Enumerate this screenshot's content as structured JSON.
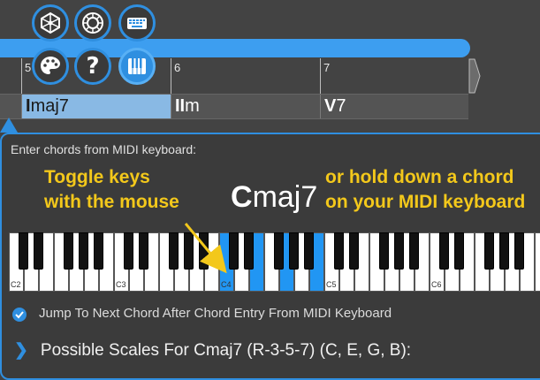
{
  "toolbar": {
    "buttons": [
      {
        "name": "network-icon"
      },
      {
        "name": "circle-of-fifths-icon"
      },
      {
        "name": "keyboard-icon"
      },
      {
        "name": "palette-icon"
      },
      {
        "name": "help-icon",
        "glyph": "?"
      },
      {
        "name": "piano-icon",
        "active": true
      }
    ],
    "accent": "#2f8fe0"
  },
  "timeline": {
    "measures": [
      "5",
      "6",
      "7"
    ]
  },
  "chord_lane": {
    "chords": [
      {
        "numeral": "I",
        "quality": "maj7",
        "selected": true
      },
      {
        "numeral": "II",
        "quality": "m",
        "selected": false
      },
      {
        "numeral": "V",
        "quality": "7",
        "selected": false
      }
    ]
  },
  "panel": {
    "title": "Enter chords from MIDI keyboard:",
    "hint_left_1": "Toggle keys",
    "hint_left_2": "with the mouse",
    "hint_right_1": "or hold down a chord",
    "hint_right_2": "on your MIDI keyboard",
    "chord_root": "C",
    "chord_quality": "maj7",
    "highlight_color": "#f3c81b"
  },
  "keyboard": {
    "octave_labels": [
      "C2",
      "C3",
      "C4",
      "C5",
      "C6"
    ],
    "active_notes": [
      "C4",
      "E4",
      "G4",
      "B4"
    ]
  },
  "options": {
    "jump_label": "Jump To Next Chord After Chord Entry From MIDI Keyboard",
    "jump_checked": true
  },
  "scales": {
    "label": "Possible Scales For Cmaj7 (R-3-5-7) (C, E, G, B):"
  }
}
